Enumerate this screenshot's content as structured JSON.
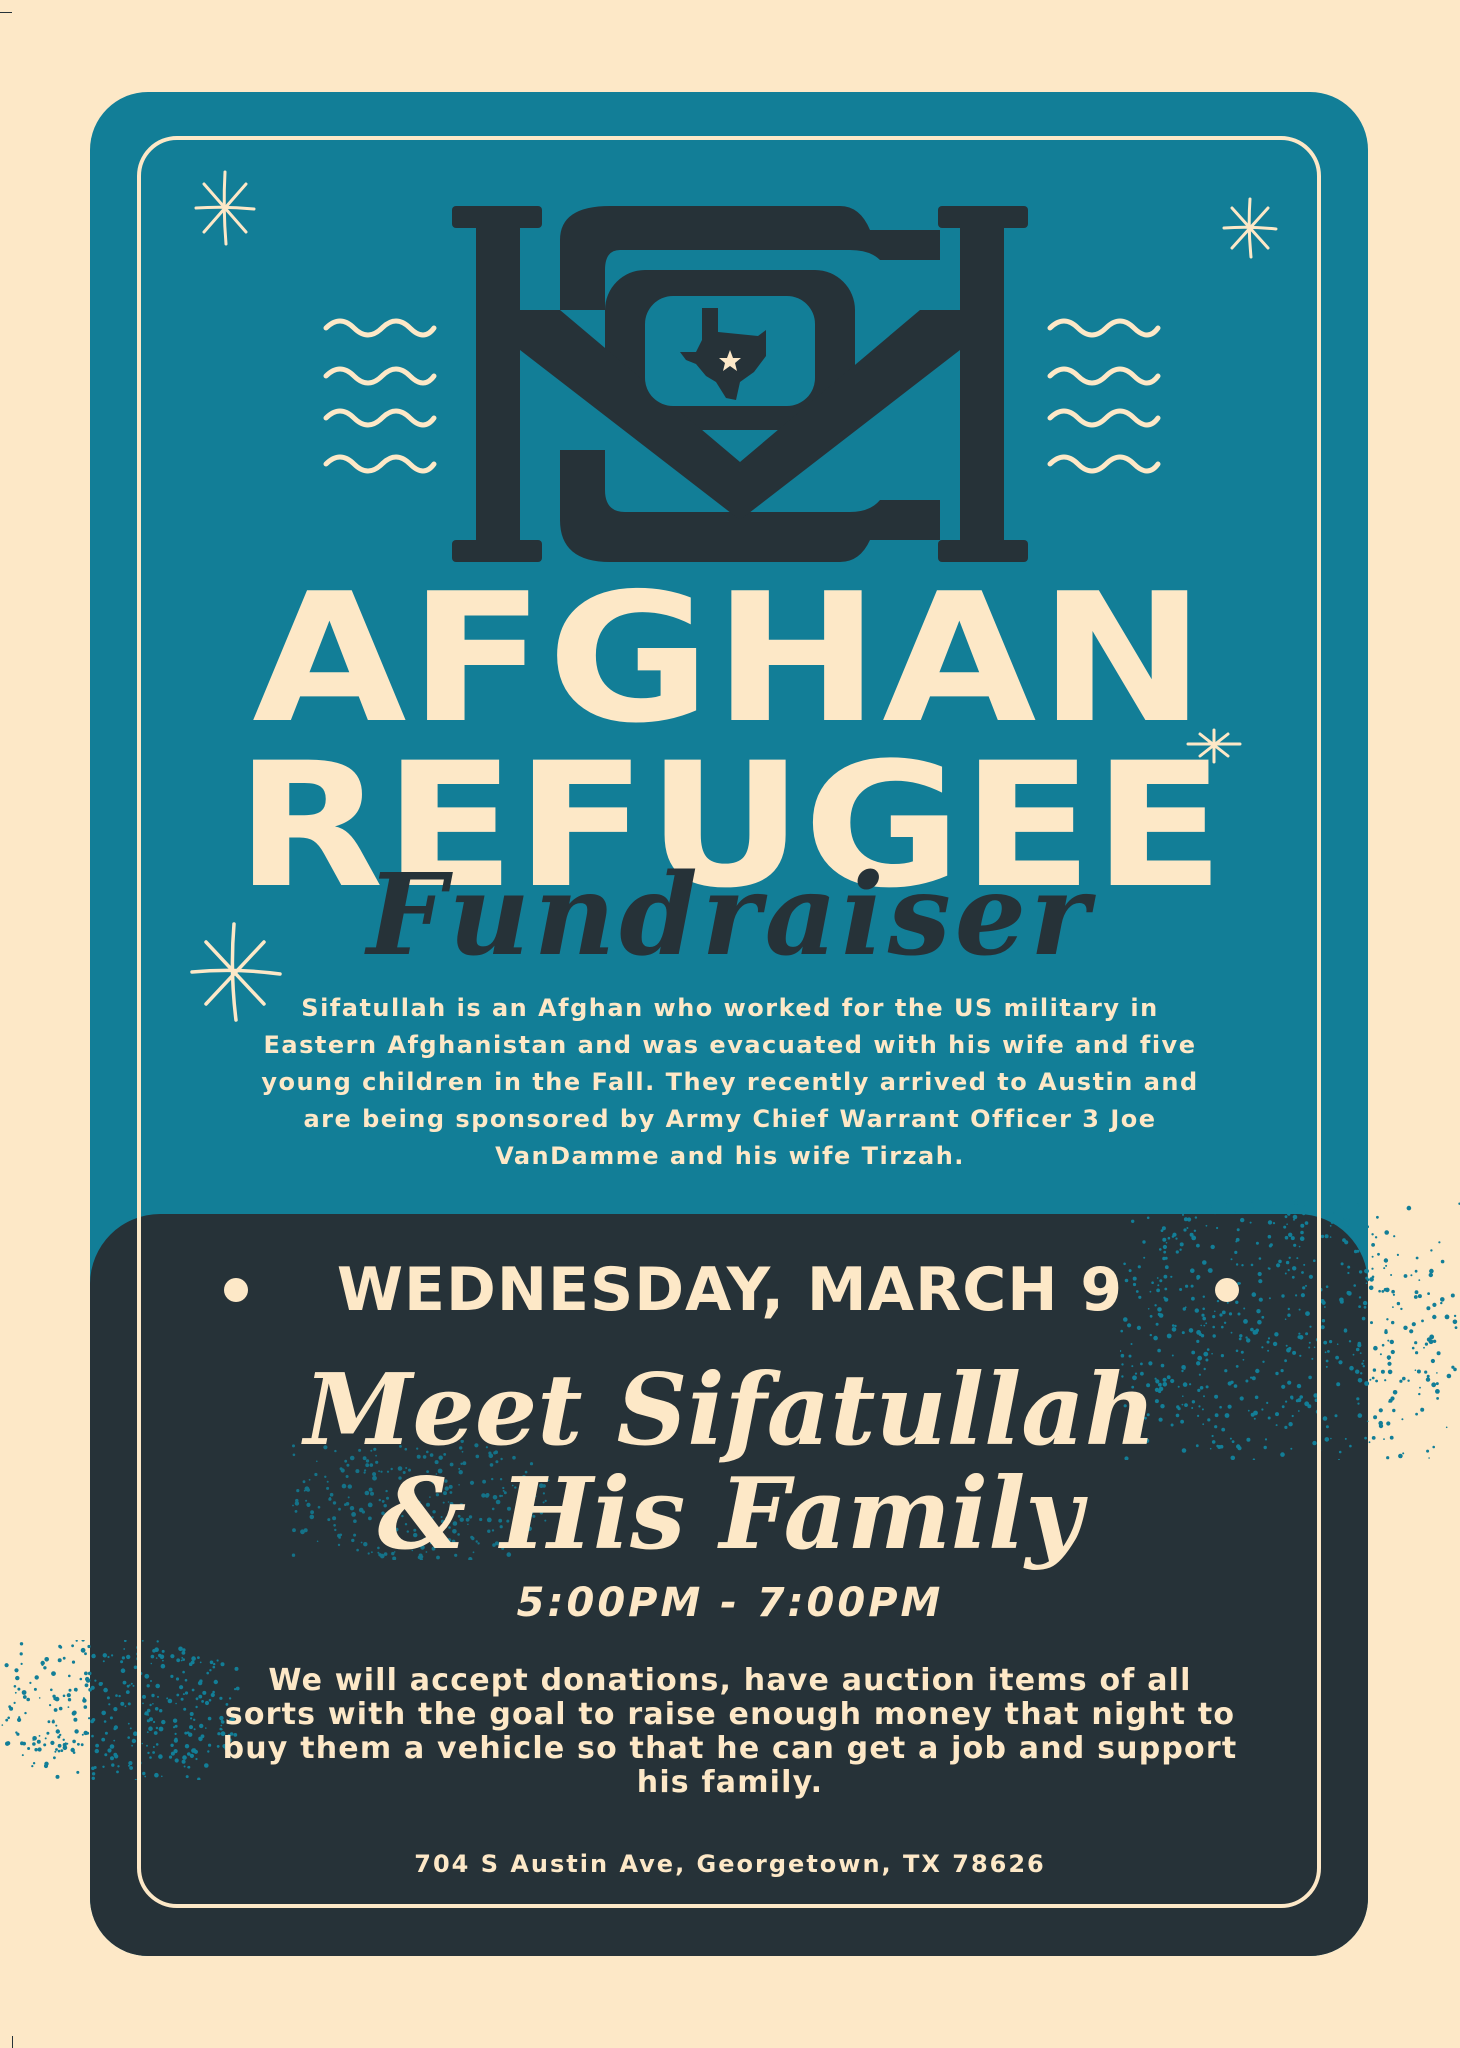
{
  "colors": {
    "background": "#fde8c7",
    "teal": "#127e97",
    "dark": "#263238",
    "cream": "#fde8c7"
  },
  "logo": {
    "icon": "ck-monogram-with-texas-icon"
  },
  "title": {
    "line1": "AFGHAN",
    "line2": "REFUGEE",
    "script": "Fundraiser"
  },
  "intro": "Sifatullah is an Afghan who worked for the US military in Eastern Afghanistan and was evacuated with his wife and five young children in the Fall. They recently arrived to Austin and are being sponsored by Army Chief Warrant Officer 3 Joe VanDamme and his wife Tirzah.",
  "event": {
    "date": "WEDNESDAY, MARCH 9",
    "headline_line1": "Meet Sifatullah",
    "headline_line2": "& His Family",
    "time": "5:00PM - 7:00PM",
    "details": "We will accept donations, have auction items of all sorts with the goal to raise enough money that night to buy them a vehicle so that he can get a job and support his family.",
    "address": "704 S Austin Ave, Georgetown, TX 78626"
  }
}
